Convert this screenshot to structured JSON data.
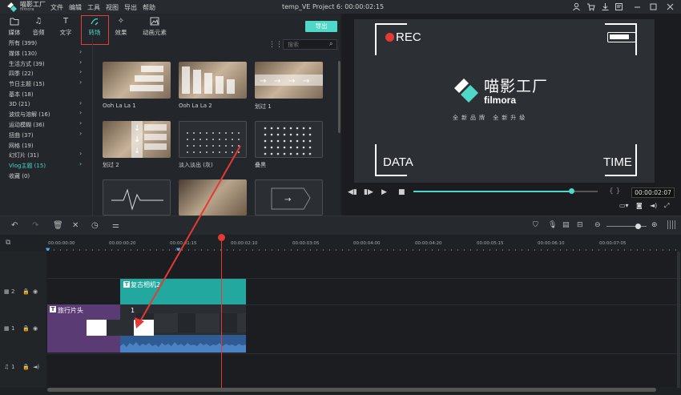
{
  "app": {
    "logo_name": "喵影工厂",
    "logo_sub": "filmora",
    "window_title": "temp_VE Project 6: 00:00:02:15"
  },
  "menu": [
    "文件",
    "编辑",
    "工具",
    "视图",
    "导出",
    "帮助"
  ],
  "tabs": [
    {
      "label": "媒体",
      "icon": "folder-icon"
    },
    {
      "label": "音频",
      "icon": "music-icon"
    },
    {
      "label": "文字",
      "icon": "text-icon"
    },
    {
      "label": "转场",
      "icon": "transition-icon"
    },
    {
      "label": "效果",
      "icon": "effects-icon"
    },
    {
      "label": "动画元素",
      "icon": "elements-icon"
    }
  ],
  "export_label": "导出",
  "categories": [
    {
      "label": "所有 (399)"
    },
    {
      "label": "媒体 (130)"
    },
    {
      "label": "生活方式 (39)"
    },
    {
      "label": "四季 (22)"
    },
    {
      "label": "节日主题 (15)"
    },
    {
      "label": "基本 (18)"
    },
    {
      "label": "3D (21)"
    },
    {
      "label": "波纹与溶解 (16)"
    },
    {
      "label": "运动模糊 (36)"
    },
    {
      "label": "扭曲 (37)"
    },
    {
      "label": "网格 (19)"
    },
    {
      "label": "幻灯片 (31)"
    },
    {
      "label": "Vlog主题 (15)"
    },
    {
      "label": "收藏 (0)"
    }
  ],
  "search_placeholder": "搜索",
  "thumbnails": [
    {
      "label": "Ooh La La 1"
    },
    {
      "label": "Ooh La La 2"
    },
    {
      "label": "划过 1"
    },
    {
      "label": "划过 2"
    },
    {
      "label": "淡入淡出 (灰)"
    },
    {
      "label": "叠黑"
    },
    {
      "label": ""
    },
    {
      "label": ""
    },
    {
      "label": ""
    }
  ],
  "preview": {
    "rec": "REC",
    "data": "DATA",
    "time": "TIME",
    "brand_cn": "喵影工厂",
    "brand_en": "filmora",
    "slogan": "全新品牌     全新升级",
    "timecode": "00:00:02:07",
    "progress": 0.86
  },
  "ruler_ticks": [
    "00:00:00:00",
    "00:00:00:20",
    "00:00:01:15",
    "00:00:02:10",
    "00:00:03:05",
    "00:00:04:00",
    "00:00:04:20",
    "00:00:05:15",
    "00:00:06:10",
    "00:00:07:05"
  ],
  "tracks": [
    {
      "label": "2"
    },
    {
      "label": "1"
    },
    {
      "label": "1"
    }
  ],
  "clips": {
    "title2": "复古相机2",
    "travel": "旅行片头",
    "video_label": "1"
  },
  "colors": {
    "accent": "#4fd8c8",
    "playhead": "#e53935",
    "highlight": "#e0403a"
  }
}
